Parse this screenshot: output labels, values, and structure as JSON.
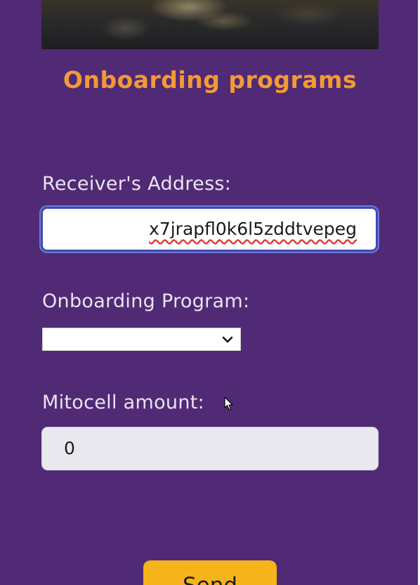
{
  "header": {
    "title": "Onboarding programs"
  },
  "form": {
    "address": {
      "label": "Receiver's Address:",
      "value": "x7jrapfl0k6l5zddtvepeg"
    },
    "program": {
      "label": "Onboarding Program:",
      "selected": ""
    },
    "amount": {
      "label": "Mitocell amount:",
      "value": "0"
    },
    "send_label": "Send"
  },
  "colors": {
    "background": "#512a76",
    "title": "#f29a35",
    "button": "#f5b41b",
    "focus_ring": "#3f4ab1"
  },
  "icons": {
    "select_arrow": "chevron-down-icon",
    "pointer": "mouse-cursor-icon"
  }
}
